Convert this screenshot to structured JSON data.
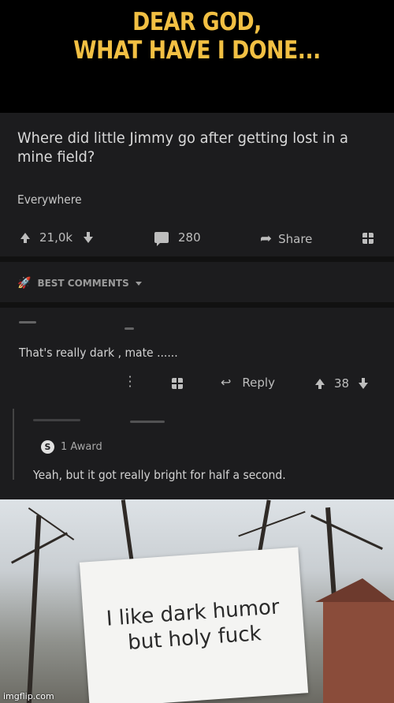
{
  "caption": {
    "line1": "DEAR GOD,",
    "line2": "WHAT HAVE I DONE..."
  },
  "post": {
    "title": "Where did little Jimmy go after getting lost in a mine field?",
    "body": "Everywhere",
    "upvotes": "21,0k",
    "comments": "280",
    "share_label": "Share"
  },
  "comments_header": {
    "label": "BEST COMMENTS"
  },
  "comment1": {
    "text": "That's really dark , mate ......",
    "reply_label": "Reply",
    "score": "38"
  },
  "comment2": {
    "award": "1 Award",
    "award_icon_letter": "S",
    "text": "Yeah, but it got really bright for half a second."
  },
  "photo": {
    "sign_text": "I like dark humor\nbut holy fuck",
    "watermark": "imgflip.com"
  },
  "colors": {
    "caption": "#f2c043",
    "post_bg": "#1c1c1e",
    "text": "#d2d2d2"
  }
}
